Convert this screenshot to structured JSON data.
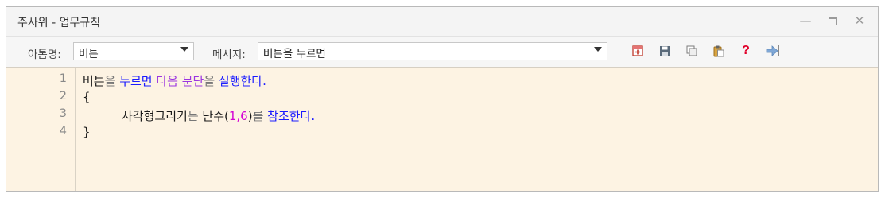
{
  "window": {
    "title": "주사위 - 업무규칙"
  },
  "toolbar": {
    "name_label": "아톰명:",
    "name_value": "버튼",
    "message_label": "메시지:",
    "message_value": "버튼을 누르면",
    "icons": [
      "add-icon",
      "save-icon",
      "copy-icon",
      "paste-icon",
      "help-icon",
      "export-icon"
    ]
  },
  "editor": {
    "line_numbers": [
      "1",
      "2",
      "3",
      "4"
    ],
    "lines": [
      [
        {
          "t": "버튼",
          "c": "dark"
        },
        {
          "t": "을 ",
          "c": "gray"
        },
        {
          "t": "누르면 ",
          "c": "blue"
        },
        {
          "t": "다음 문단",
          "c": "purple"
        },
        {
          "t": "을 ",
          "c": "gray"
        },
        {
          "t": "실행한다.",
          "c": "blue"
        }
      ],
      [
        {
          "t": "{",
          "c": "dark"
        }
      ],
      [
        {
          "t": "사각형그리기",
          "c": "dark"
        },
        {
          "t": "는 ",
          "c": "gray"
        },
        {
          "t": "난수(",
          "c": "dark"
        },
        {
          "t": "1,6",
          "c": "magenta"
        },
        {
          "t": ")",
          "c": "dark"
        },
        {
          "t": "를 ",
          "c": "gray"
        },
        {
          "t": "참조한다.",
          "c": "blue"
        }
      ],
      [
        {
          "t": "}",
          "c": "dark"
        }
      ]
    ]
  },
  "colors": {
    "editor_bg": "#fdf3e3",
    "blue": "#1c1cff",
    "purple": "#9b34e0",
    "magenta": "#d400d4"
  }
}
